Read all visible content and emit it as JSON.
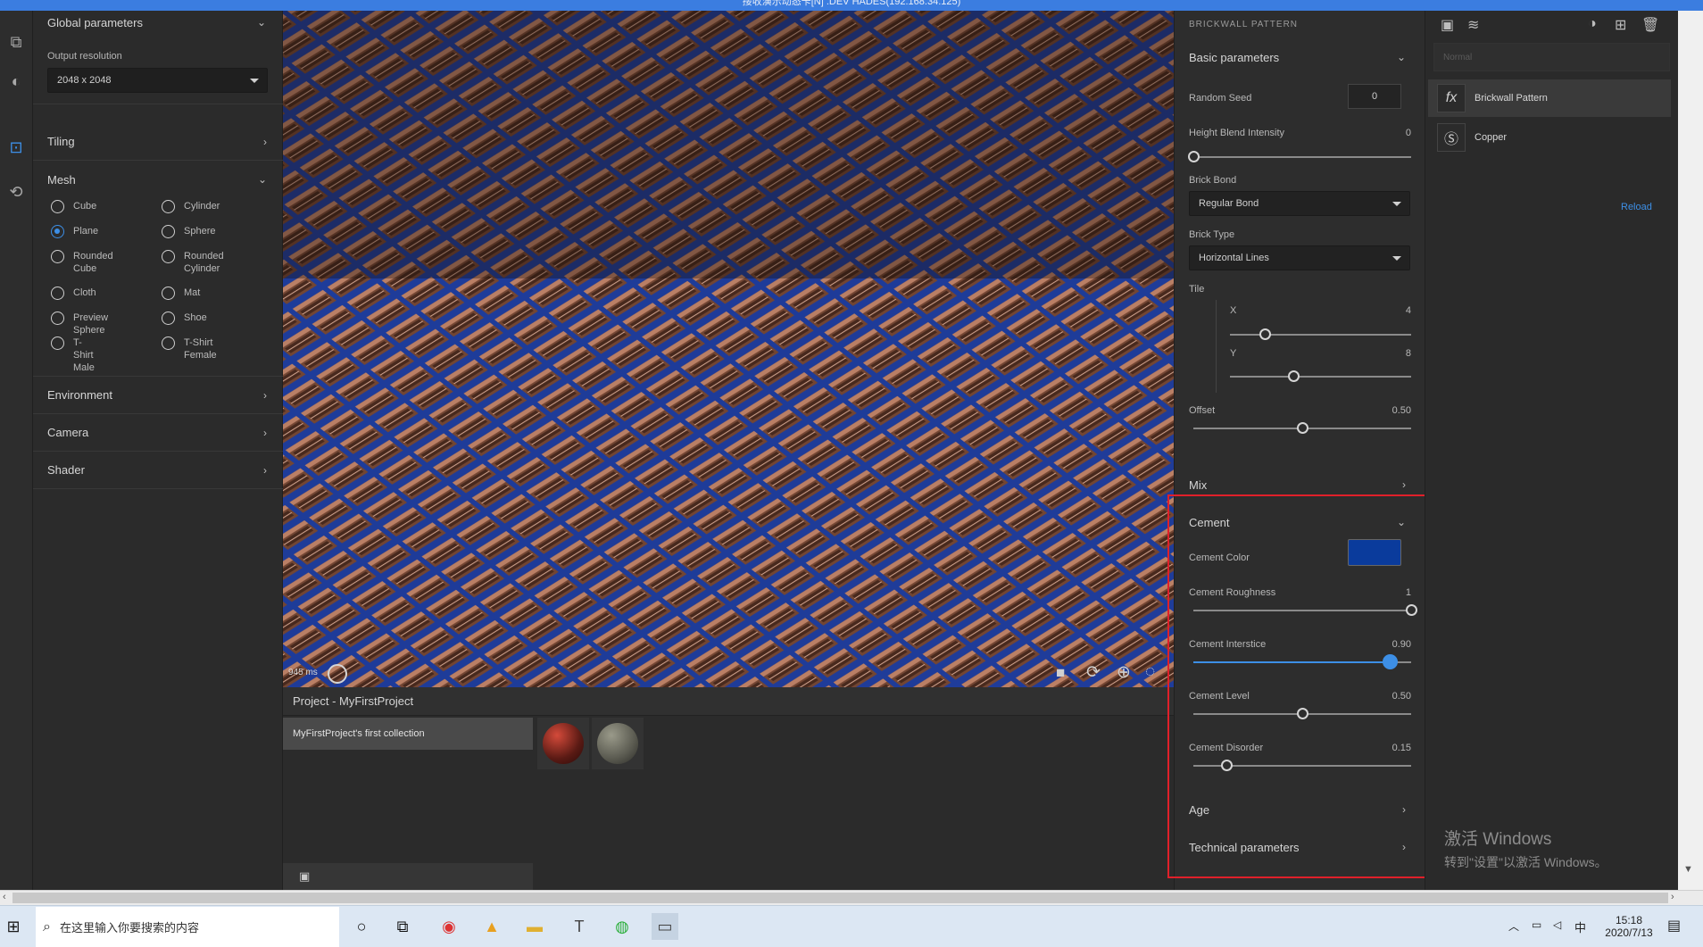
{
  "window": {
    "title": "接收演示动态卡[N] .DEV HADES(192.168.34.125)"
  },
  "left_panel": {
    "global_parameters": "Global parameters",
    "output_resolution_label": "Output resolution",
    "output_resolution_value": "2048 x 2048",
    "tiling": "Tiling",
    "mesh": "Mesh",
    "mesh_options": [
      "Cube",
      "Cylinder",
      "Plane",
      "Sphere",
      "Rounded Cube",
      "Rounded Cylinder",
      "Cloth",
      "Mat",
      "Preview Sphere",
      "Shoe",
      "T-Shirt Male",
      "T-Shirt Female"
    ],
    "mesh_selected": "Plane",
    "environment": "Environment",
    "camera": "Camera",
    "shader": "Shader"
  },
  "viewport": {
    "render_time": "945 ms"
  },
  "project": {
    "title": "Project - MyFirstProject",
    "collection": "MyFirstProject's first collection"
  },
  "right_panel": {
    "header": "BRICKWALL PATTERN",
    "basic_parameters": "Basic parameters",
    "random_seed_label": "Random Seed",
    "random_seed_value": "0",
    "height_blend_label": "Height Blend Intensity",
    "height_blend_value": "0",
    "brick_bond_label": "Brick Bond",
    "brick_bond_value": "Regular Bond",
    "brick_type_label": "Brick Type",
    "brick_type_value": "Horizontal Lines",
    "tile_label": "Tile",
    "tile_x_label": "X",
    "tile_x_value": "4",
    "tile_y_label": "Y",
    "tile_y_value": "8",
    "offset_label": "Offset",
    "offset_value": "0.50",
    "mix": "Mix",
    "cement": "Cement",
    "cement_color_label": "Cement Color",
    "cement_color": "#0a3b9c",
    "cement_roughness_label": "Cement Roughness",
    "cement_roughness_value": "1",
    "cement_interstice_label": "Cement Interstice",
    "cement_interstice_value": "0.90",
    "cement_level_label": "Cement Level",
    "cement_level_value": "0.50",
    "cement_disorder_label": "Cement Disorder",
    "cement_disorder_value": "0.15",
    "age": "Age",
    "technical_parameters": "Technical parameters"
  },
  "layers_panel": {
    "blend_mode": "Normal",
    "layers": [
      "Brickwall Pattern",
      "Copper"
    ],
    "reload": "Reload"
  },
  "watermark": {
    "line1": "激活 Windows",
    "line2": "转到\"设置\"以激活 Windows。"
  },
  "taskbar": {
    "search_placeholder": "在这里输入你要搜索的内容",
    "ime": "中",
    "time": "15:18",
    "date": "2020/7/13"
  },
  "colors": {
    "accent": "#3d8fe6",
    "highlight_box": "#e0202a",
    "cement": "#0a3b9c"
  }
}
